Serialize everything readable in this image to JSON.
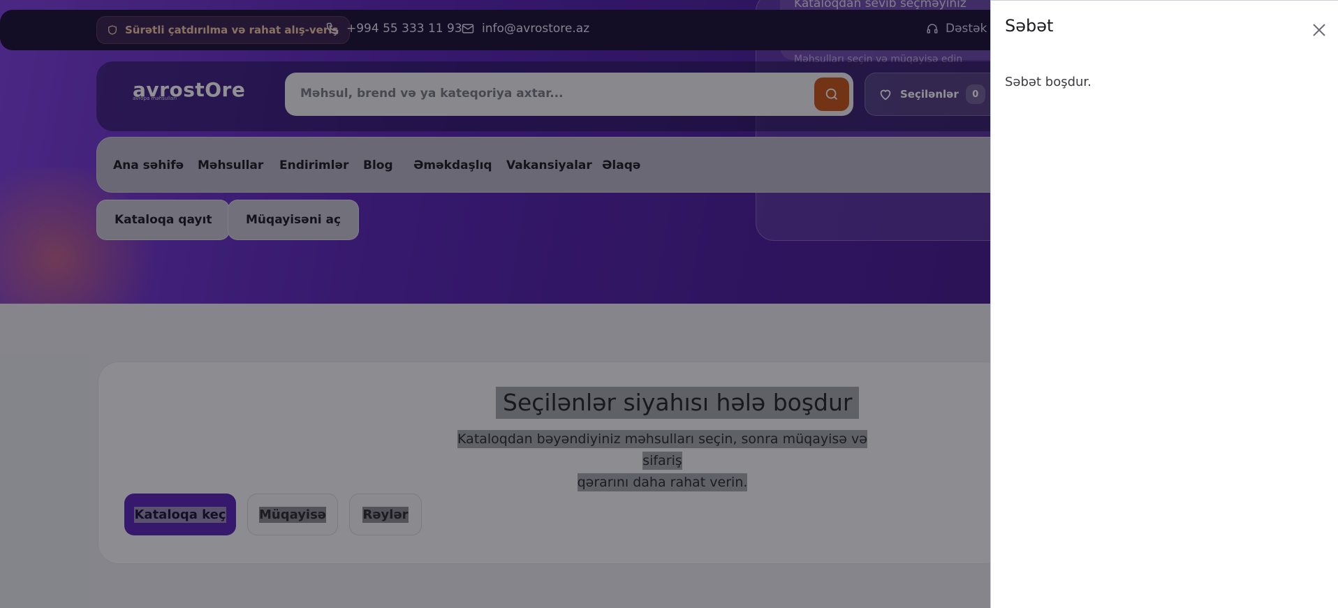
{
  "topbar": {
    "promo": "Sürətli çatdırılma və rahat alış-veriş",
    "phone": "+994 55 333 11 93",
    "email": "info@avrostore.az",
    "support": "Dəstək"
  },
  "hero": {
    "right_card_line": "Kataloqdan sevib seçməyiniz",
    "right_card_line2": "Məhsulları seçin və müqayisə edin"
  },
  "header": {
    "logo": "avrostOre",
    "logo_sub": "avropa məhsulları",
    "search_placeholder": "Məhsul, brend və ya kateqoriya axtar...",
    "favorites_label": "Seçilənlər",
    "favorites_count": "0"
  },
  "nav": {
    "items": [
      "Ana səhifə",
      "Məhsullar",
      "Endirimlər",
      "Blog",
      "Əməkdaşlıq",
      "Vakansiyalar",
      "Əlaqə"
    ]
  },
  "page_actions": {
    "back_to_catalog": "Kataloqa qayıt",
    "open_compare": "Müqayisəni aç"
  },
  "empty_state": {
    "title": "Seçilənlər siyahısı hələ boşdur",
    "text_line1": "Kataloqdan bəyəndiyiniz məhsulları seçin, sonra müqayisə və sifariş",
    "text_line2": "qərarını daha rahat verin.",
    "btn_catalog": "Kataloqa keç",
    "btn_compare": "Müqayisə",
    "btn_reviews": "Rəylər"
  },
  "cart": {
    "title": "Səbət",
    "empty_message": "Səbət boşdur."
  },
  "colors": {
    "hero_purple": "#5a24b8",
    "search_orange": "#c9561a",
    "topbar_dark": "#1a1138"
  }
}
